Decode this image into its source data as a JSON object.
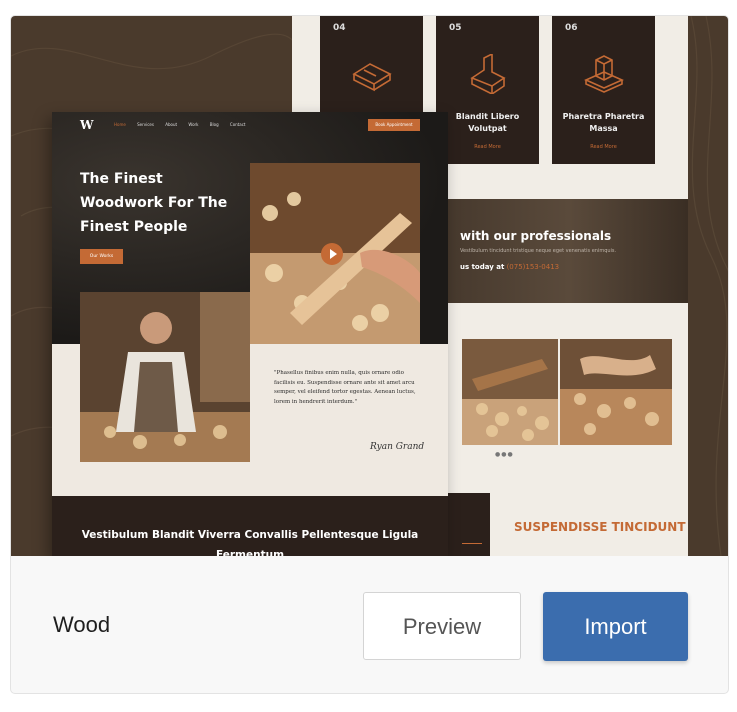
{
  "template_card": {
    "name": "Wood",
    "preview_label": "Preview",
    "import_label": "Import",
    "accent_color": "#3b6dae"
  },
  "thumbnail": {
    "front_page": {
      "logo": "W",
      "nav_links": [
        "Home",
        "Services",
        "About",
        "Work",
        "Blog",
        "Contact"
      ],
      "nav_button": "Book Appointment",
      "headline": "The Finest Woodwork For The Finest People",
      "hero_button": "Our Works",
      "quote": "\"Phasellus finibus enim nulla, quis ornare odio facilisis eu. Suspendisse ornare ante sit amet arcu semper, vel eleifend tortor egestas. Aenean luctus, lorem in hendrerit interdum.\"",
      "signature": "Ryan Grand",
      "section_title": "Vestibulum Blandit Viverra Convallis Pellentesque Ligula Fermentum"
    },
    "back_page": {
      "services": [
        {
          "num": "04",
          "title": "",
          "link": ""
        },
        {
          "num": "05",
          "title": "Blandit Libero Volutpat",
          "link": "Read More"
        },
        {
          "num": "06",
          "title": "Pharetra Pharetra Massa",
          "link": "Read More"
        }
      ],
      "band_title": "with our professionals",
      "band_text": "Vestibulum tincidunt tristique neque eget venenatis enimquis.",
      "band_call": "us today at",
      "band_phone": "(075)153-0413",
      "section_title": "SUSPENDISSE TINCIDUNT"
    },
    "brand_color": "#c46a35"
  }
}
